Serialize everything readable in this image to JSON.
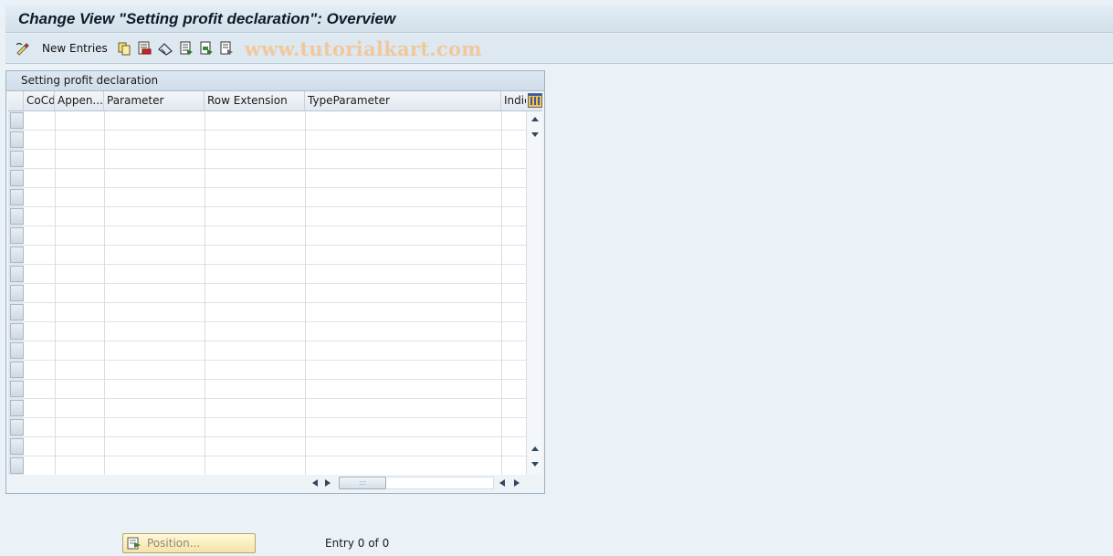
{
  "window": {
    "title": "Change View \"Setting profit declaration\": Overview"
  },
  "toolbar": {
    "new_entries_label": "New Entries",
    "watermark": "www.tutorialkart.com",
    "icons": [
      "change-display-icon",
      "copy-icon",
      "delete-icon",
      "undo-icon",
      "select-all-icon",
      "select-block-icon",
      "deselect-all-icon"
    ]
  },
  "table": {
    "title": "Setting profit declaration",
    "columns": [
      "CoCd",
      "Appen...",
      "Parameter",
      "Row Extension",
      "TypeParameter",
      "Indic"
    ],
    "row_count_visible": 19
  },
  "footer": {
    "position_label": "Position...",
    "entry_info": "Entry 0 of 0"
  },
  "colors": {
    "background": "#eaf1f7",
    "panel_header": "#cfdde9",
    "position_button": "#f5e4a8"
  }
}
